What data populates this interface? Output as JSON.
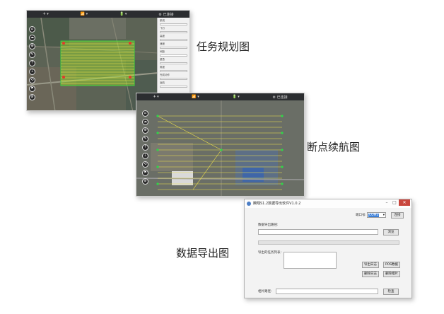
{
  "captions": {
    "planning": "任务规划图",
    "resume": "断点续航图",
    "export": "数据导出图"
  },
  "planning_window": {
    "topbar": [
      "✈ ▾",
      "📶 ▾",
      "🔋 ▾",
      "⚙ 已连接"
    ],
    "tools": [
      "⌂",
      "☁",
      "⊕",
      "✎",
      "⇡",
      "⇣",
      "⟲",
      "⚑",
      "⚙"
    ],
    "panel_labels": [
      "航线",
      "飞行",
      "高度",
      "速度",
      "间距",
      "重叠",
      "角度",
      "完成动作",
      "返航"
    ]
  },
  "resume_window": {
    "topbar": [
      "✈ ▾",
      "📶 ▾",
      "🔋 ▾",
      "⚙ 已连接"
    ],
    "tools": [
      "⌂",
      "☁",
      "⊕",
      "✎",
      "⇡",
      "⇣",
      "⟲",
      "⚑",
      "⚙"
    ]
  },
  "export_tool": {
    "title": "腾翔S1.2数据导出软件V1.0.2",
    "port_label": "端口号:",
    "port_value": "COM3",
    "connect_button": "连接",
    "save_path_label": "数据导出路径:",
    "browse_button": "浏览",
    "task_list_label": "导出的任务列表:",
    "export_log_button": "导出日志",
    "export_pos_button": "POS数据",
    "delete_log_button": "删除日志",
    "delete_photo_button": "删除相片",
    "photo_path_label": "相片路径:",
    "check_button": "检查"
  },
  "colors": {
    "route_line": "#f1e34a",
    "area_fill": "#9be02f",
    "waypoint": "#2fd54a",
    "marker": "#e23a2a",
    "accent": "#3b7fd8"
  }
}
